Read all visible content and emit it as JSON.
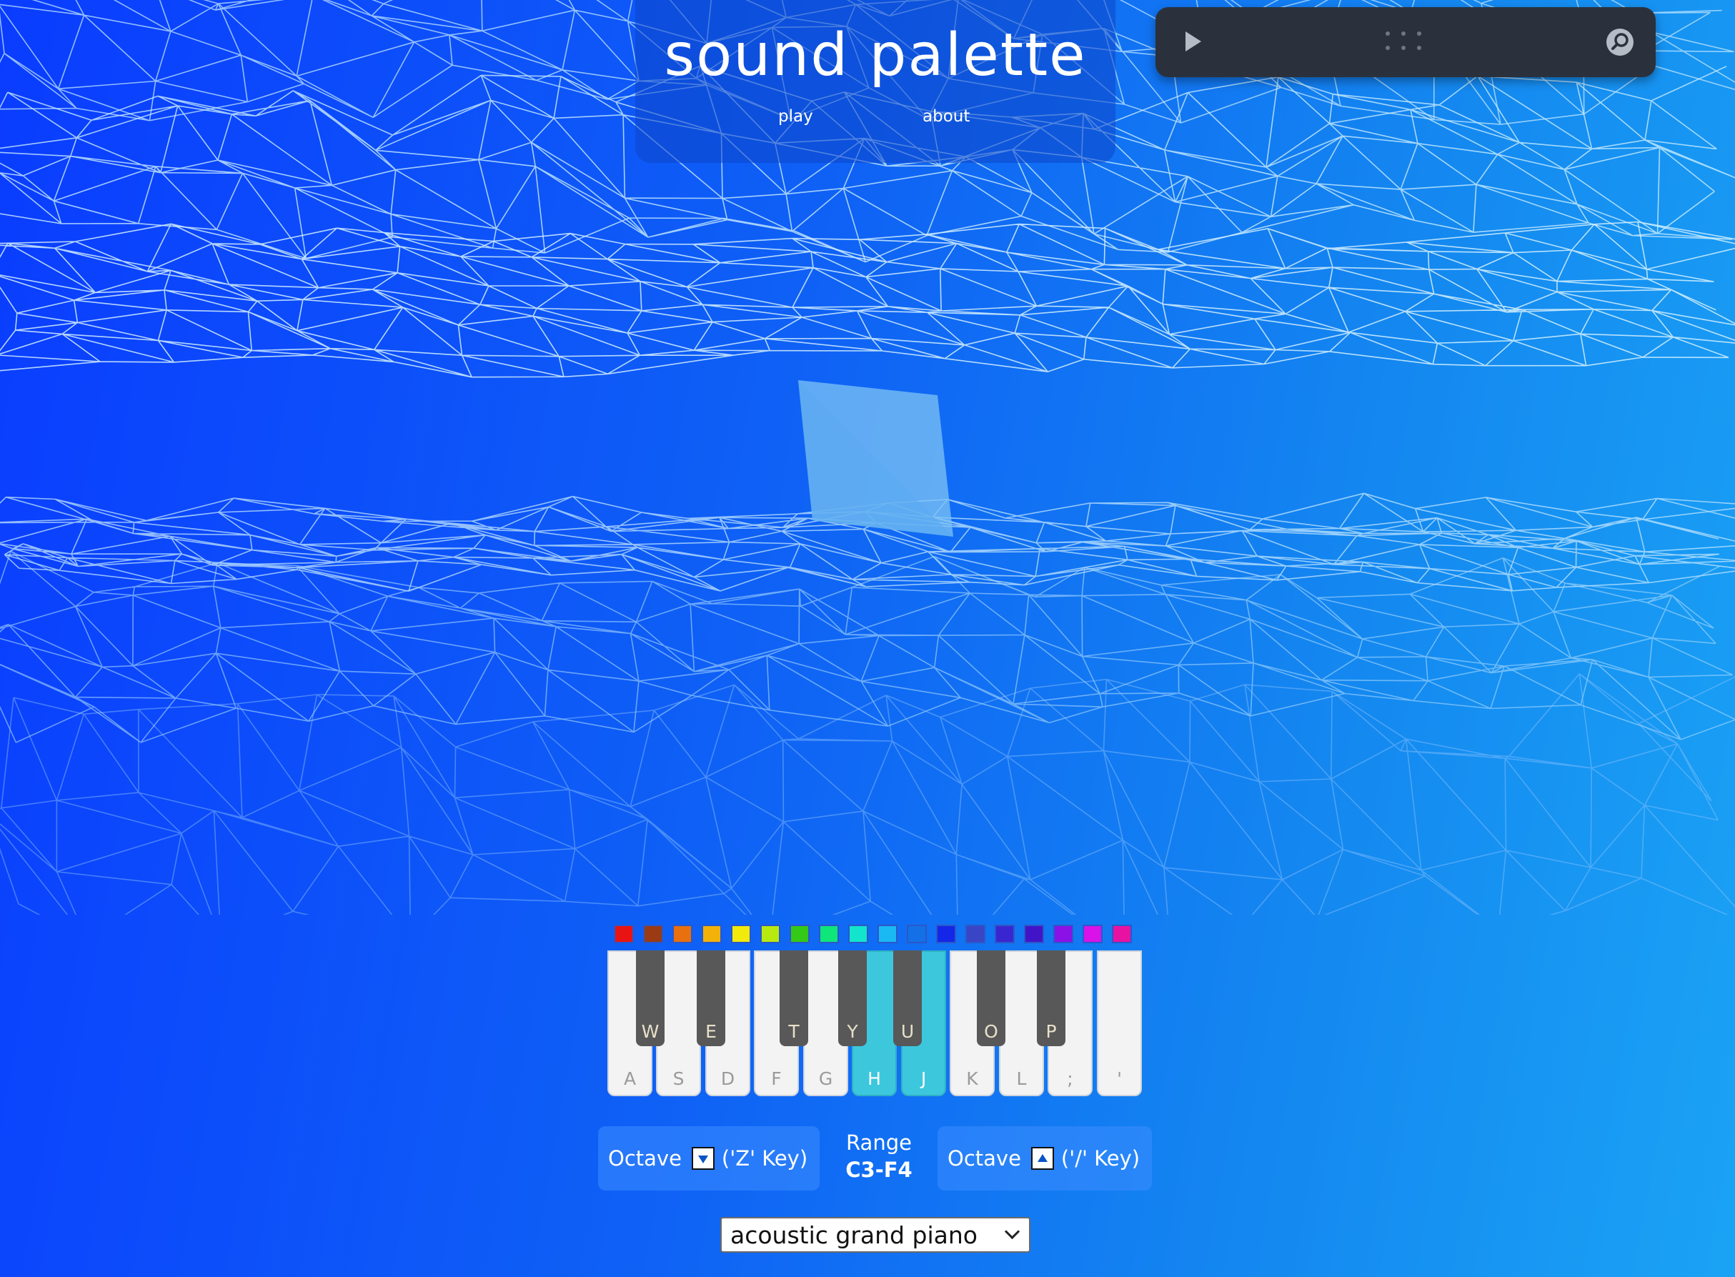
{
  "header": {
    "title": "sound palette",
    "nav": [
      {
        "label": "play"
      },
      {
        "label": "about"
      }
    ]
  },
  "player": {
    "play_icon": "play-icon",
    "grip_icon": "drag-handle-icon",
    "search_icon": "search-icon"
  },
  "palette": {
    "colors": [
      "#e81414",
      "#9a3b14",
      "#e8700f",
      "#f2b20a",
      "#f2ea0a",
      "#b8ea10",
      "#34c916",
      "#0ee67a",
      "#12e5cc",
      "#1ab9f4",
      "#1470e6",
      "#1426e8",
      "#3a45c6",
      "#3a26d0",
      "#4214c8",
      "#8a12e6",
      "#d812e8",
      "#e812a2"
    ]
  },
  "keyboard": {
    "white_keys": [
      {
        "label": "A",
        "active": false
      },
      {
        "label": "S",
        "active": false
      },
      {
        "label": "D",
        "active": false
      },
      {
        "label": "F",
        "active": false
      },
      {
        "label": "G",
        "active": false
      },
      {
        "label": "H",
        "active": true
      },
      {
        "label": "J",
        "active": true
      },
      {
        "label": "K",
        "active": false
      },
      {
        "label": "L",
        "active": false
      },
      {
        "label": ";",
        "active": false
      },
      {
        "label": "'",
        "active": false
      }
    ],
    "black_keys": [
      {
        "label": "W",
        "active": false
      },
      {
        "label": "E",
        "active": false
      },
      {
        "label": "T",
        "active": false
      },
      {
        "label": "Y",
        "active": false
      },
      {
        "label": "U",
        "active": false
      },
      {
        "label": "O",
        "active": false
      },
      {
        "label": "P",
        "active": false
      }
    ]
  },
  "controls": {
    "octave_down": {
      "label": "Octave",
      "hint": "('Z' Key)"
    },
    "range": {
      "label": "Range",
      "value": "C3-F4"
    },
    "octave_up": {
      "label": "Octave",
      "hint": "('/' Key)"
    }
  },
  "instrument": {
    "selected": "acoustic grand piano"
  },
  "colors": {
    "accent_active_key": "#3cc7dd",
    "player_bg": "#2b313c"
  }
}
